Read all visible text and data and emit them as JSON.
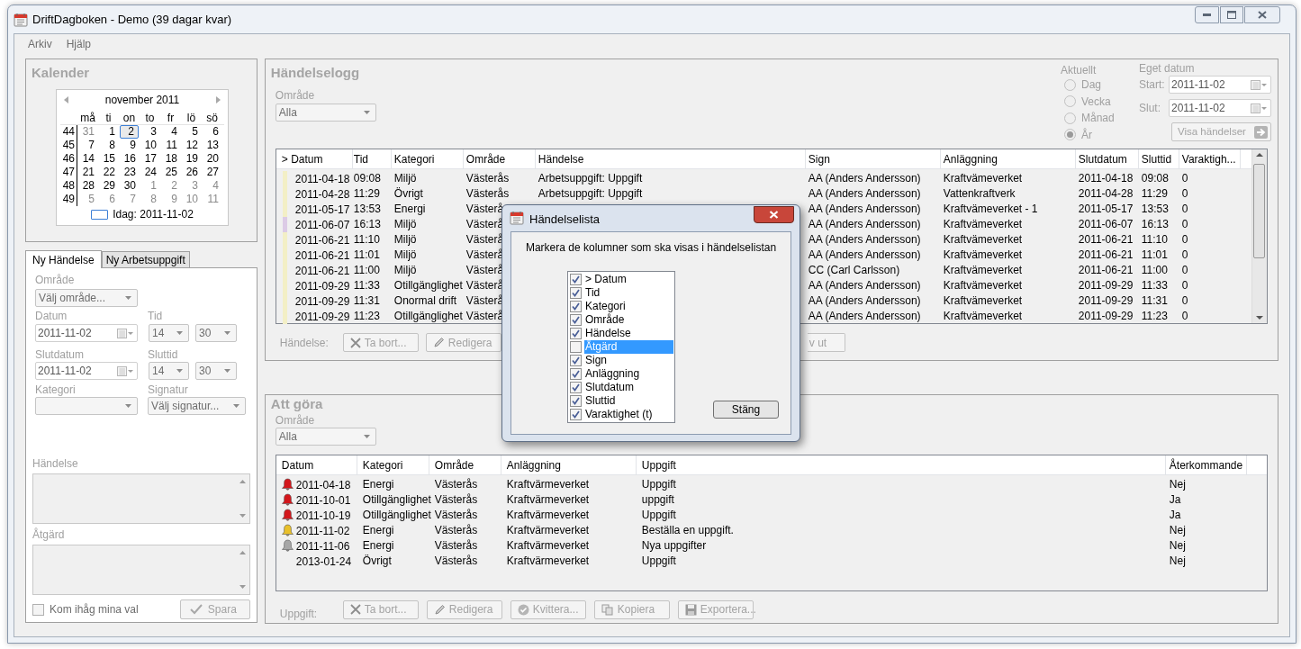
{
  "window": {
    "title": "DriftDagboken - Demo (39 dagar kvar)"
  },
  "menu": [
    "Arkiv",
    "Hjälp"
  ],
  "calendar_panel": {
    "title": "Kalender",
    "month": "november 2011",
    "weekdays": [
      "må",
      "ti",
      "on",
      "to",
      "fr",
      "lö",
      "sö"
    ],
    "weeks": [
      {
        "number": "44",
        "days": [
          {
            "label": "31",
            "muted": true,
            "selected": false
          },
          {
            "label": "1",
            "muted": false,
            "selected": false
          },
          {
            "label": "2",
            "muted": false,
            "selected": true
          },
          {
            "label": "3",
            "muted": false,
            "selected": false
          },
          {
            "label": "4",
            "muted": false,
            "selected": false
          },
          {
            "label": "5",
            "muted": false,
            "selected": false
          },
          {
            "label": "6",
            "muted": false,
            "selected": false
          }
        ]
      },
      {
        "number": "45",
        "days": [
          {
            "label": "7",
            "muted": false,
            "selected": false
          },
          {
            "label": "8",
            "muted": false,
            "selected": false
          },
          {
            "label": "9",
            "muted": false,
            "selected": false
          },
          {
            "label": "10",
            "muted": false,
            "selected": false
          },
          {
            "label": "11",
            "muted": false,
            "selected": false
          },
          {
            "label": "12",
            "muted": false,
            "selected": false
          },
          {
            "label": "13",
            "muted": false,
            "selected": false
          }
        ]
      },
      {
        "number": "46",
        "days": [
          {
            "label": "14",
            "muted": false,
            "selected": false
          },
          {
            "label": "15",
            "muted": false,
            "selected": false
          },
          {
            "label": "16",
            "muted": false,
            "selected": false
          },
          {
            "label": "17",
            "muted": false,
            "selected": false
          },
          {
            "label": "18",
            "muted": false,
            "selected": false
          },
          {
            "label": "19",
            "muted": false,
            "selected": false
          },
          {
            "label": "20",
            "muted": false,
            "selected": false
          }
        ]
      },
      {
        "number": "47",
        "days": [
          {
            "label": "21",
            "muted": false,
            "selected": false
          },
          {
            "label": "22",
            "muted": false,
            "selected": false
          },
          {
            "label": "23",
            "muted": false,
            "selected": false
          },
          {
            "label": "24",
            "muted": false,
            "selected": false
          },
          {
            "label": "25",
            "muted": false,
            "selected": false
          },
          {
            "label": "26",
            "muted": false,
            "selected": false
          },
          {
            "label": "27",
            "muted": false,
            "selected": false
          }
        ]
      },
      {
        "number": "48",
        "days": [
          {
            "label": "28",
            "muted": false,
            "selected": false
          },
          {
            "label": "29",
            "muted": false,
            "selected": false
          },
          {
            "label": "30",
            "muted": false,
            "selected": false
          },
          {
            "label": "1",
            "muted": true,
            "selected": false
          },
          {
            "label": "2",
            "muted": true,
            "selected": false
          },
          {
            "label": "3",
            "muted": true,
            "selected": false
          },
          {
            "label": "4",
            "muted": true,
            "selected": false
          }
        ]
      },
      {
        "number": "49",
        "days": [
          {
            "label": "5",
            "muted": true,
            "selected": false
          },
          {
            "label": "6",
            "muted": true,
            "selected": false
          },
          {
            "label": "7",
            "muted": true,
            "selected": false
          },
          {
            "label": "8",
            "muted": true,
            "selected": false
          },
          {
            "label": "9",
            "muted": true,
            "selected": false
          },
          {
            "label": "10",
            "muted": true,
            "selected": false
          },
          {
            "label": "11",
            "muted": true,
            "selected": false
          }
        ]
      }
    ],
    "today": "Idag: 2011-11-02"
  },
  "tabs": [
    {
      "label": "Ny Händelse",
      "selected": true
    },
    {
      "label": "Ny Arbetsuppgift",
      "selected": false
    }
  ],
  "form": {
    "area": {
      "label": "Område",
      "value": "Välj område..."
    },
    "date": {
      "label": "Datum",
      "value": "2011-11-02"
    },
    "time": {
      "label": "Tid",
      "hour": "14",
      "minute": "30"
    },
    "end_date": {
      "label": "Slutdatum",
      "value": "2011-11-02"
    },
    "end_time": {
      "label": "Sluttid",
      "hour": "14",
      "minute": "30"
    },
    "category": {
      "label": "Kategori"
    },
    "signature": {
      "label": "Signatur",
      "value": "Välj signatur..."
    },
    "event": {
      "label": "Händelse"
    },
    "action": {
      "label": "Åtgärd"
    },
    "remember": {
      "label": "Kom ihåg mina val",
      "checked": false
    },
    "save_button": "Spara"
  },
  "event_log": {
    "title": "Händelselogg",
    "area_label": "Område",
    "area_value": "Alla",
    "period": {
      "label": "Aktuellt",
      "options": [
        {
          "label": "Dag",
          "selected": false
        },
        {
          "label": "Vecka",
          "selected": false
        },
        {
          "label": "Månad",
          "selected": false
        },
        {
          "label": "År",
          "selected": true
        }
      ]
    },
    "custom_date": {
      "label": "Eget datum",
      "start_label": "Start:",
      "start": "2011-11-02",
      "end_label": "Slut:",
      "end": "2011-11-02",
      "button": "Visa händelser"
    },
    "columns": [
      "> Datum",
      "Tid",
      "Kategori",
      "Område",
      "Händelse",
      "Sign",
      "Anläggning",
      "Slutdatum",
      "Sluttid",
      "Varaktigh..."
    ],
    "rows": [
      {
        "color": "#f3efc6",
        "date": "2011-04-18",
        "time": "09:08",
        "category": "Miljö",
        "area": "Västerås",
        "event": "Arbetsuppgift: Uppgift",
        "sign": "AA (Anders Andersson)",
        "facility": "Kraftvämeverket",
        "end_date": "2011-04-18",
        "end_time": "09:08",
        "duration": "0"
      },
      {
        "color": "#f3efc6",
        "date": "2011-04-28",
        "time": "11:29",
        "category": "Övrigt",
        "area": "Västerås",
        "event": "Arbetsuppgift: Uppgift",
        "sign": "AA (Anders Andersson)",
        "facility": "Vattenkraftverk",
        "end_date": "2011-04-28",
        "end_time": "11:29",
        "duration": "0"
      },
      {
        "color": "#f3efc6",
        "date": "2011-05-17",
        "time": "13:53",
        "category": "Energi",
        "area": "Västerå",
        "sign": "AA (Anders Andersson)",
        "facility": "Kraftvämeverket - 1",
        "end_date": "2011-05-17",
        "end_time": "13:53",
        "duration": "0"
      },
      {
        "color": "#dccbe6",
        "date": "2011-06-07",
        "time": "16:13",
        "category": "Miljö",
        "area": "Västerå",
        "sign": "AA (Anders Andersson)",
        "facility": "Kraftvämeverket",
        "end_date": "2011-06-07",
        "end_time": "16:13",
        "duration": "0"
      },
      {
        "color": "#f3efc6",
        "date": "2011-06-21",
        "time": "11:10",
        "category": "Miljö",
        "area": "Västerå",
        "sign": "AA (Anders Andersson)",
        "facility": "Kraftvämeverket",
        "end_date": "2011-06-21",
        "end_time": "11:10",
        "duration": "0"
      },
      {
        "color": "#f3efc6",
        "date": "2011-06-21",
        "time": "11:01",
        "category": "Miljö",
        "area": "Västerå",
        "sign": "AA (Anders Andersson)",
        "facility": "Kraftvämeverket",
        "end_date": "2011-06-21",
        "end_time": "11:01",
        "duration": "0"
      },
      {
        "color": "#f3efc6",
        "date": "2011-06-21",
        "time": "11:00",
        "category": "Miljö",
        "area": "Västerå",
        "sign": "CC (Carl Carlsson)",
        "facility": "Kraftvämeverket",
        "end_date": "2011-06-21",
        "end_time": "11:00",
        "duration": "0"
      },
      {
        "color": "#f3efc6",
        "date": "2011-09-29",
        "time": "11:33",
        "category": "Otillgänglighet",
        "area": "Västerå",
        "sign": "AA (Anders Andersson)",
        "facility": "Kraftvämeverket",
        "end_date": "2011-09-29",
        "end_time": "11:33",
        "duration": "0"
      },
      {
        "color": "#f3efc6",
        "date": "2011-09-29",
        "time": "11:31",
        "category": "Onormal drift",
        "area": "Västerå",
        "sign": "AA (Anders Andersson)",
        "facility": "Kraftvämeverket",
        "end_date": "2011-09-29",
        "end_time": "11:31",
        "duration": "0"
      },
      {
        "color": "#f3efc6",
        "date": "2011-09-29",
        "time": "11:23",
        "category": "Otillgänglighet",
        "area": "Västerå",
        "sign": "AA (Anders Andersson)",
        "facility": "Kraftvämeverket",
        "end_date": "2011-09-29",
        "end_time": "11:23",
        "duration": "0"
      }
    ],
    "actions_label": "Händelse:",
    "actions": [
      "Ta bort...",
      "Redigera",
      "v ut"
    ]
  },
  "todo": {
    "title": "Att göra",
    "area_label": "Område",
    "area_value": "Alla",
    "columns": [
      "Datum",
      "Kategori",
      "Område",
      "Anläggning",
      "Uppgift",
      "Återkommande"
    ],
    "rows": [
      {
        "kind": "overdue",
        "date": "2011-04-18",
        "category": "Energi",
        "area": "Västerås",
        "facility": "Kraftvärmeverket",
        "task": "Uppgift",
        "recurring": "Nej"
      },
      {
        "kind": "overdue",
        "date": "2011-10-01",
        "category": "Otillgänglighet",
        "area": "Västerås",
        "facility": "Kraftvärmeverket",
        "task": "uppgift",
        "recurring": "Ja"
      },
      {
        "kind": "overdue",
        "date": "2011-10-19",
        "category": "Otillgänglighet",
        "area": "Västerås",
        "facility": "Kraftvärmeverket",
        "task": "Uppgift",
        "recurring": "Ja"
      },
      {
        "kind": "due",
        "date": "2011-11-02",
        "category": "Energi",
        "area": "Västerås",
        "facility": "Kraftvärmeverket",
        "task": "Beställa en uppgift.",
        "recurring": "Nej"
      },
      {
        "kind": "later",
        "date": "2011-11-06",
        "category": "Energi",
        "area": "Västerås",
        "facility": "Kraftvärmeverket",
        "task": "Nya uppgifter",
        "recurring": "Nej"
      },
      {
        "kind": "none",
        "date": "2013-01-24",
        "category": "Övrigt",
        "area": "Västerås",
        "facility": "Kraftvärmeverket",
        "task": "Uppgift",
        "recurring": "Nej"
      }
    ],
    "actions_label": "Uppgift:",
    "actions": [
      "Ta bort...",
      "Redigera",
      "Kvittera...",
      "Kopiera",
      "Exportera..."
    ]
  },
  "dialog": {
    "title": "Händelselista",
    "instruction": "Markera de kolumner som ska visas i händelselistan",
    "items": [
      {
        "label": "> Datum",
        "checked": true,
        "selected": false
      },
      {
        "label": "Tid",
        "checked": true,
        "selected": false
      },
      {
        "label": "Kategori",
        "checked": true,
        "selected": false
      },
      {
        "label": "Område",
        "checked": true,
        "selected": false
      },
      {
        "label": "Händelse",
        "checked": true,
        "selected": false
      },
      {
        "label": "Åtgärd",
        "checked": false,
        "selected": true
      },
      {
        "label": "Sign",
        "checked": true,
        "selected": false
      },
      {
        "label": "Anläggning",
        "checked": true,
        "selected": false
      },
      {
        "label": "Slutdatum",
        "checked": true,
        "selected": false
      },
      {
        "label": "Sluttid",
        "checked": true,
        "selected": false
      },
      {
        "label": "Varaktighet (t)",
        "checked": true,
        "selected": false
      }
    ],
    "close_button": "Stäng"
  }
}
